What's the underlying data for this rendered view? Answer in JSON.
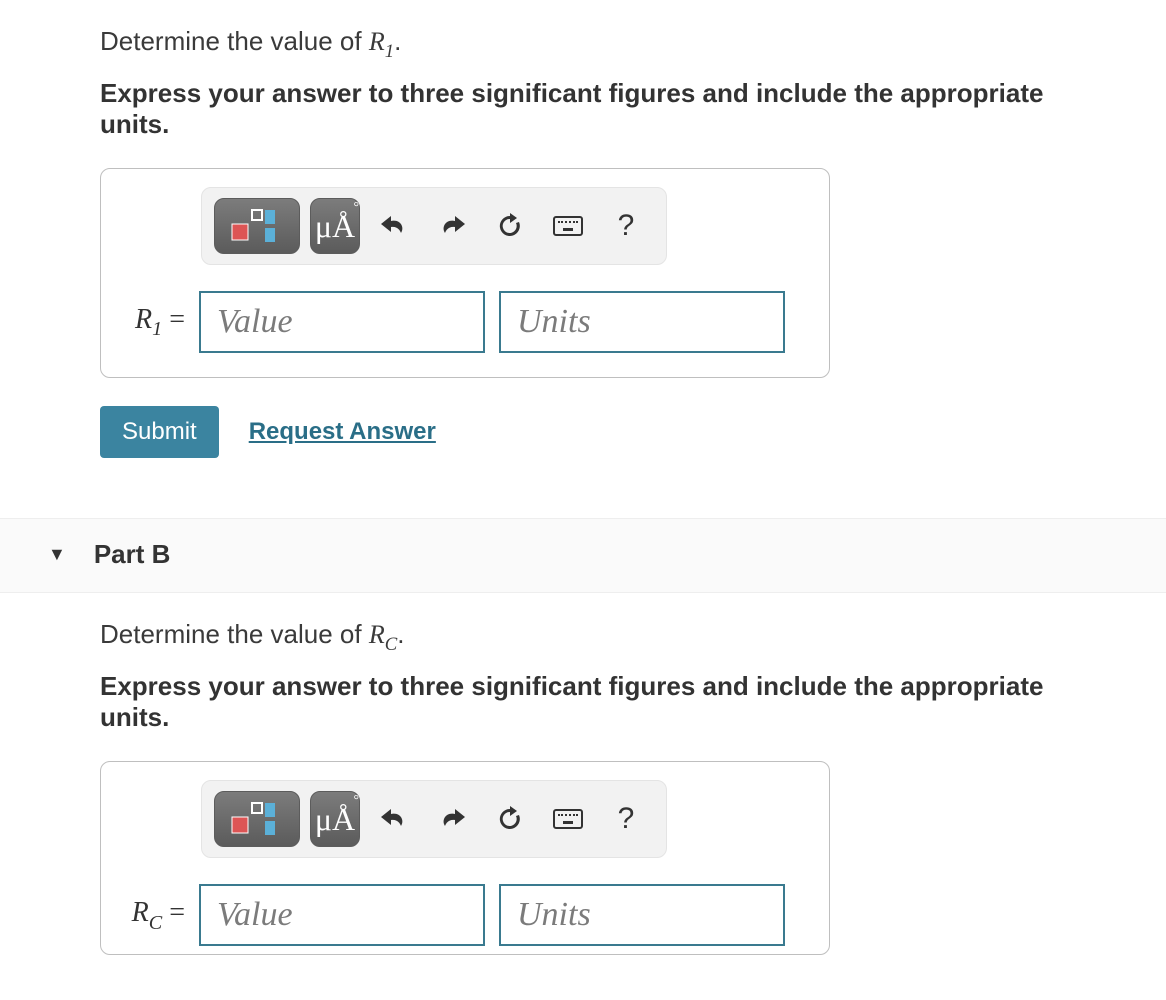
{
  "partA": {
    "prompt_prefix": "Determine the value of ",
    "prompt_var": "R",
    "prompt_sub": "1",
    "prompt_suffix": ".",
    "instructions": "Express your answer to three significant figures and include the appropriate units.",
    "toolbar": {
      "units_btn": "μÅ",
      "help": "?"
    },
    "label_var": "R",
    "label_sub": "1",
    "label_eq": " =",
    "value_placeholder": "Value",
    "units_placeholder": "Units",
    "submit": "Submit",
    "request": "Request Answer"
  },
  "partB": {
    "header": "Part B",
    "prompt_prefix": "Determine the value of ",
    "prompt_var": "R",
    "prompt_sub": "C",
    "prompt_suffix": ".",
    "instructions": "Express your answer to three significant figures and include the appropriate units.",
    "toolbar": {
      "units_btn": "μÅ",
      "help": "?"
    },
    "label_var": "R",
    "label_sub": "C",
    "label_eq": " =",
    "value_placeholder": "Value",
    "units_placeholder": "Units"
  }
}
